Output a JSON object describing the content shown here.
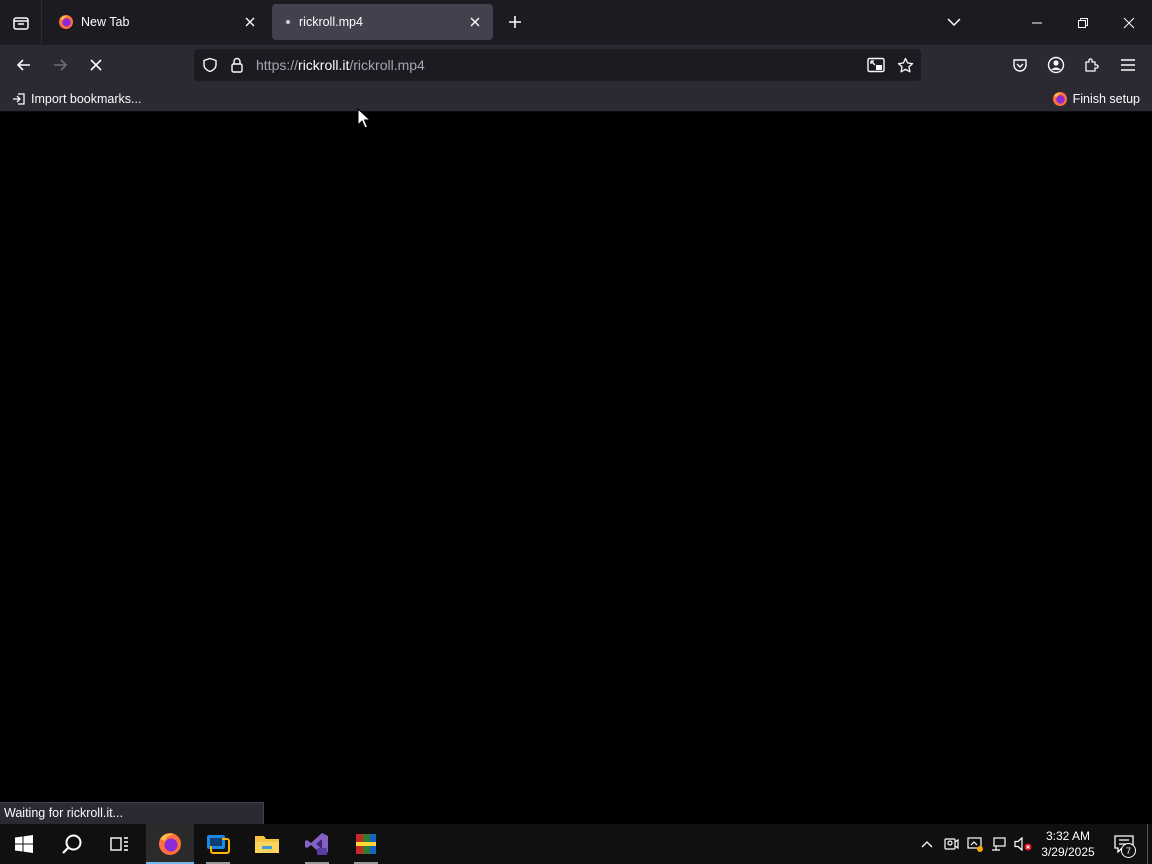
{
  "tabs": [
    {
      "title": "New Tab",
      "icon": "firefox-logo-icon",
      "active": false
    },
    {
      "title": "rickroll.mp4",
      "icon": "loading-dot-icon",
      "active": true
    }
  ],
  "url": {
    "scheme": "https://",
    "host": "rickroll.it",
    "path": "/rickroll.mp4"
  },
  "bookmarks": {
    "import_label": "Import bookmarks...",
    "finish_label": "Finish setup"
  },
  "status": {
    "text": "Waiting for rickroll.it..."
  },
  "taskbar": {
    "apps": [
      "windows-start-icon",
      "search-icon",
      "task-view-icon",
      "firefox-icon",
      "remote-desktop-icon",
      "file-explorer-icon",
      "visual-studio-icon",
      "winrar-icon"
    ],
    "clock": {
      "time": "3:32 AM",
      "date": "3/29/2025"
    },
    "notification_count": "7"
  },
  "colors": {
    "tabstrip": "#1c1b22",
    "toolbar": "#2b2a33",
    "active_tab": "#42414d",
    "taskbar": "#101010",
    "accent": "#76b9ed"
  }
}
